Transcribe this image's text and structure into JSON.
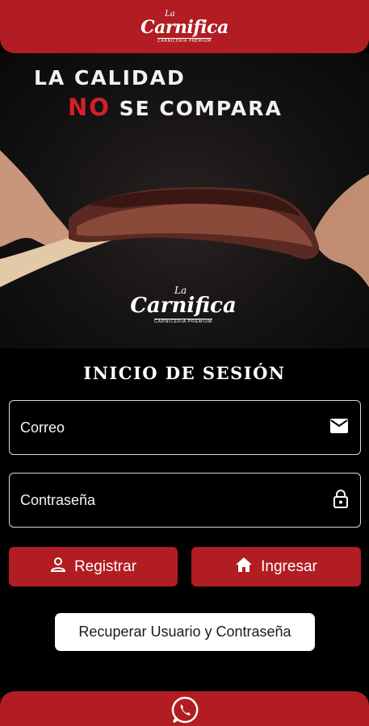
{
  "header": {
    "logo_la": "La",
    "logo_name": "Carnifica",
    "logo_sub": "CARNICERIA PREMIUM"
  },
  "hero": {
    "headline_line1": "LA CALIDAD",
    "headline_no": "NO",
    "headline_rest": " SE COMPARA",
    "logo_la": "La",
    "logo_name": "Carnifica",
    "logo_sub": "CARNICERIA PREMIUM"
  },
  "login": {
    "title": "INICIO DE SESIÓN",
    "email_placeholder": "Correo",
    "password_placeholder": "Contraseña",
    "register_label": "Registrar",
    "login_label": "Ingresar",
    "recover_label": "Recuperar Usuario y Contraseña"
  },
  "icons": {
    "email": "mail-icon",
    "password": "lock-icon",
    "register": "person-icon",
    "login": "home-icon",
    "whatsapp": "whatsapp-icon"
  },
  "colors": {
    "brand_red": "#b11d22",
    "background": "#000000",
    "accent_red_text": "#d3202a"
  }
}
